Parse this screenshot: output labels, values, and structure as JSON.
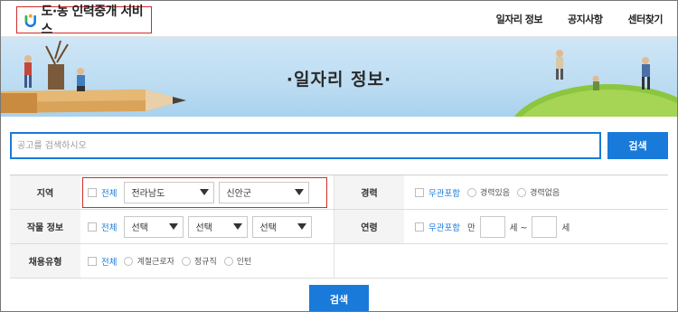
{
  "header": {
    "logo_text": "도·농 인력중개 서비스",
    "nav": [
      "일자리 정보",
      "공지사항",
      "센터찾기"
    ]
  },
  "banner": {
    "title": "·일자리 정보·"
  },
  "search": {
    "placeholder": "공고를 검색하시오",
    "button": "검색"
  },
  "filters": {
    "region": {
      "label": "지역",
      "all": "전체",
      "province": "전라남도",
      "county": "신안군"
    },
    "crop": {
      "label": "작물 정보",
      "all": "전체",
      "selects": [
        "선택",
        "선택",
        "선택"
      ]
    },
    "employment": {
      "label": "채용유형",
      "all": "전체",
      "options": [
        "계절근로자",
        "정규직",
        "인턴"
      ]
    },
    "career": {
      "label": "경력",
      "any": "무관포함",
      "options": [
        "경력있음",
        "경력없음"
      ]
    },
    "age": {
      "label": "연령",
      "any": "무관포함",
      "from_prefix": "만",
      "from_suffix": "세 ~",
      "to_suffix": "세"
    }
  },
  "bottom_button": "검색",
  "colors": {
    "accent": "#1a7ad9",
    "highlight": "#d12c2c"
  }
}
